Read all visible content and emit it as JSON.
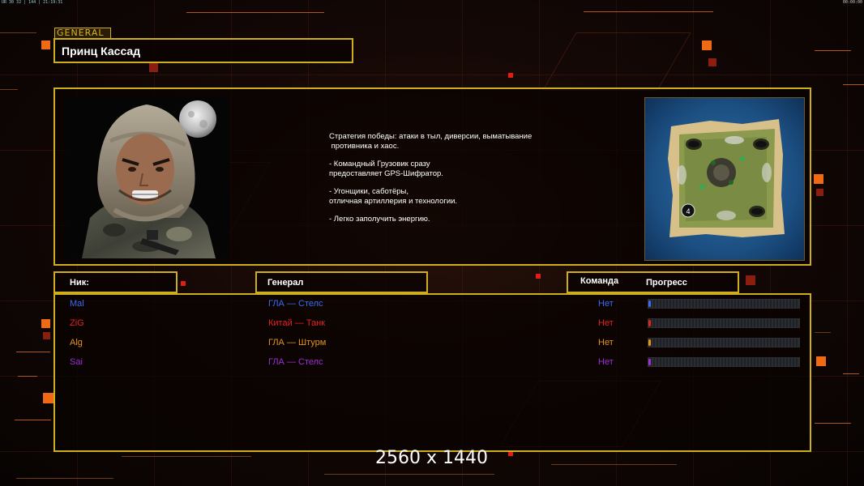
{
  "status_bar": {
    "left_text": "UR 30 32 | 144 | 21:19:31",
    "right_text": "00:00:00"
  },
  "general": {
    "tag_label": "GENERAL",
    "name": "Принц Кассад"
  },
  "description": [
    "Стратегия победы: атаки в тыл, диверсии, выматывание противника и хаос.",
    "- Командный Грузовик сразу предоставляет GPS-Шифратор.",
    "- Угонщики, саботёры, отличная артиллерия и технологии.",
    "- Легко заполучить энергию."
  ],
  "description_lines": [
    [
      "Стратегия победы: атаки в тыл, диверсии, выматывание",
      " противника и хаос."
    ],
    [
      "- Командный Грузовик сразу",
      "предоставляет GPS-Шифратор."
    ],
    [
      "- Угонщики, саботёры,",
      "отличная артиллерия и технологии."
    ],
    [
      "- Легко заполучить энергию."
    ]
  ],
  "minimap": {
    "start_marker": "4"
  },
  "table_headers": {
    "nick": "Ник:",
    "general": "Генерал",
    "team": "Команда",
    "progress": "Прогресс"
  },
  "players": [
    {
      "nick": "Mal",
      "general": "ГЛА — Стелс",
      "team": "Нет",
      "color": "#3c6af0",
      "progress": 0.0
    },
    {
      "nick": "ZiG",
      "general": "Китай — Танк",
      "team": "Нет",
      "color": "#e32222",
      "progress": 0.0
    },
    {
      "nick": "Alg",
      "general": "ГЛА — Штурм",
      "team": "Нет",
      "color": "#e2941e",
      "progress": 0.0
    },
    {
      "nick": "Sai",
      "general": "ГЛА — Стелс",
      "team": "Нет",
      "color": "#9b2fd8",
      "progress": 0.0
    }
  ],
  "resolution_label": "2560 x 1440",
  "colors": {
    "frame_gold": "#cfae1e",
    "accent_orange": "#f06a14"
  }
}
